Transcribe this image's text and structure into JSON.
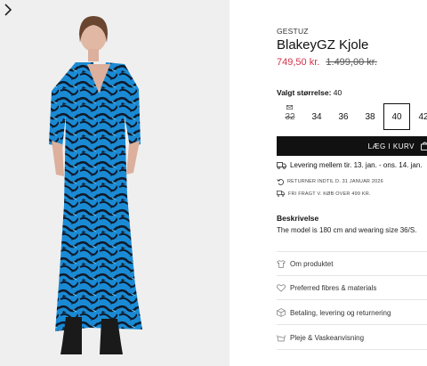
{
  "product": {
    "brand": "GESTUZ",
    "title": "BlakeyGZ Kjole",
    "price_sale": "749,50 kr.",
    "price_original": "1.499,00 kr."
  },
  "sizes": {
    "label_prefix": "Valgt størrelse:",
    "selected_value": "40",
    "options": [
      {
        "label": "32",
        "available": false
      },
      {
        "label": "34",
        "available": true
      },
      {
        "label": "36",
        "available": true
      },
      {
        "label": "38",
        "available": true
      },
      {
        "label": "40",
        "available": true
      },
      {
        "label": "42",
        "available": true
      }
    ]
  },
  "cart": {
    "button_label": "LÆG I KURV"
  },
  "shipping": {
    "delivery": "Levering mellem tir. 13. jan. - ons. 14. jan.",
    "returns": "RETURNER INDTIL D. 31 JANUAR 2026",
    "free_shipping": "FRI FRAGT V. KØB OVER 499 KR."
  },
  "description": {
    "heading": "Beskrivelse",
    "text": "The model is 180 cm and wearing size 36/S."
  },
  "accordion": [
    {
      "label": "Om produktet",
      "icon": "shirt-icon"
    },
    {
      "label": "Preferred fibres & materials",
      "icon": "heart-icon"
    },
    {
      "label": "Betaling, levering og returnering",
      "icon": "box-icon"
    },
    {
      "label": "Pleje & Vaskeanvisning",
      "icon": "wash-icon"
    }
  ],
  "colors": {
    "sale": "#d1344b",
    "dress_blue": "#1a8ad4",
    "dress_dark": "#0f1a2a",
    "button": "#111111"
  }
}
